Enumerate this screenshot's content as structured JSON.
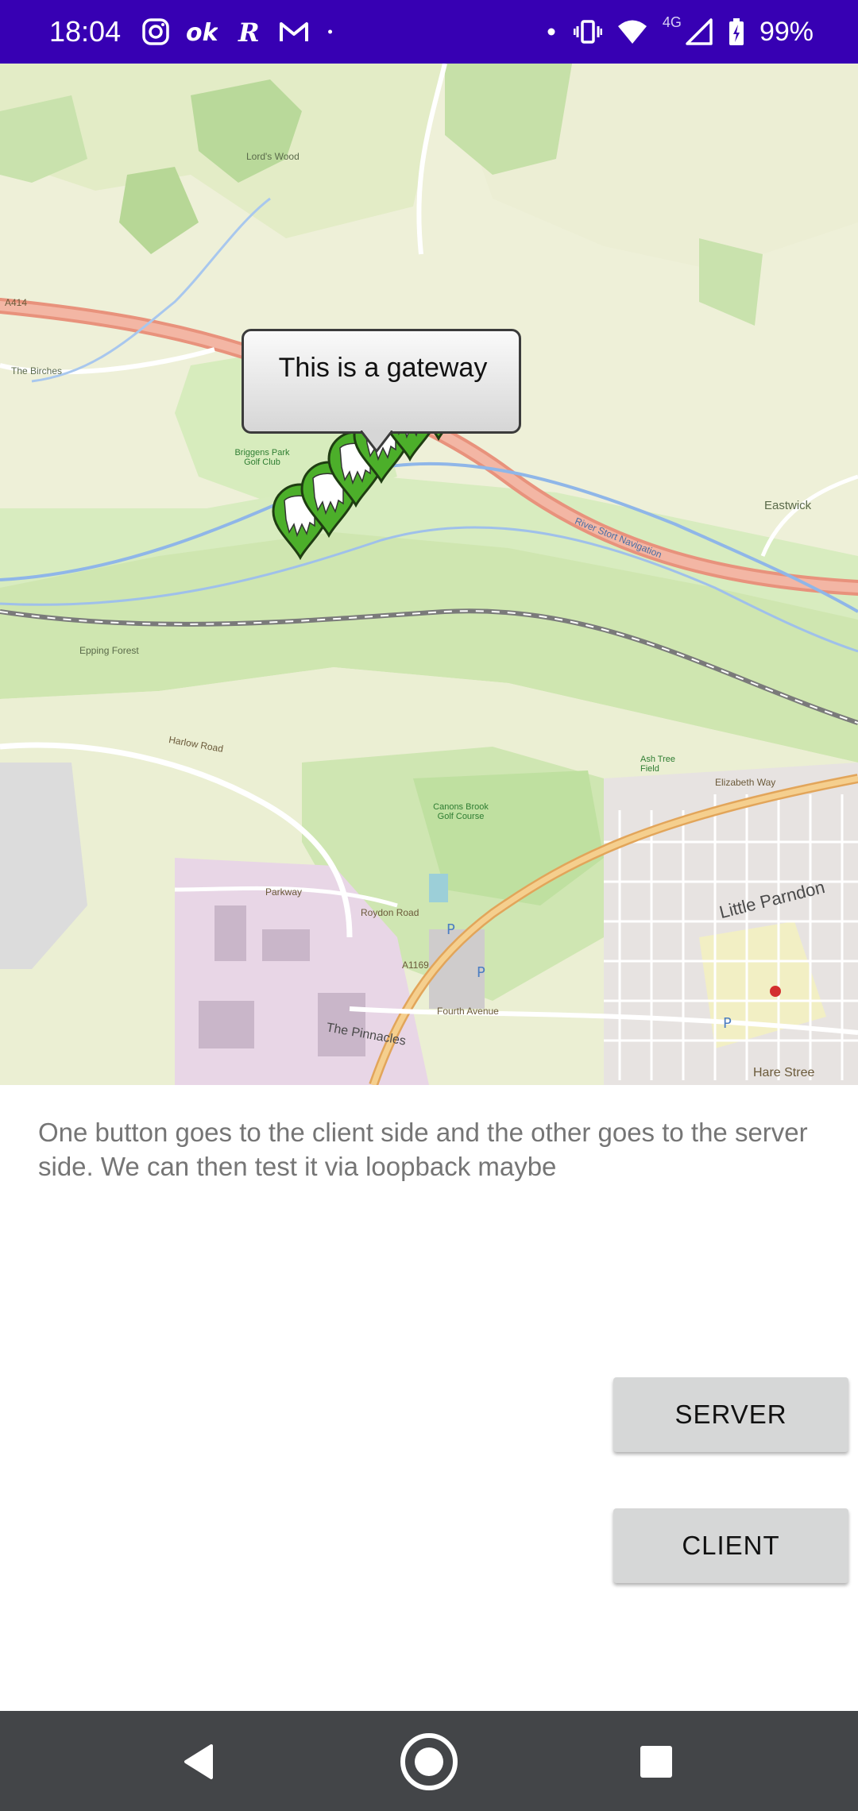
{
  "status_bar": {
    "time": "18:04",
    "network": "4G",
    "battery": "99%",
    "left_icons": [
      "instagram-icon",
      "ok-icon",
      "r-icon",
      "gmail-icon",
      "dot-icon"
    ],
    "right_icons": [
      "dot-icon",
      "vibrate-icon",
      "wifi-icon",
      "signal-icon",
      "battery-icon"
    ],
    "color": "#3700b3"
  },
  "map": {
    "callout_text": "This is a gateway",
    "marker_count": 6,
    "marker_color": "#4caf2a",
    "labels": {
      "a414": "A414",
      "lords_wood": "Lord's Wood",
      "the_birches": "The Birches",
      "briggens": "Briggens Park Golf Club",
      "eastwick": "Eastwick",
      "river_stort": "River Stort Navigation",
      "epping_forest": "Epping Forest",
      "harlow_road": "Harlow Road",
      "canons_brook": "Canons Brook Golf Course",
      "elizabeth_way": "Elizabeth Way",
      "little_parndon": "Little Parndon",
      "fourth_avenue": "Fourth Avenue",
      "the_pinnacles": "The Pinnacles",
      "a1169": "A1169",
      "roydon_road": "Roydon Road",
      "parkway": "Parkway",
      "hare_street": "Hare Stree",
      "ash_tree_field": "Ash Tree Field"
    }
  },
  "description": "One button goes to the client side and the other goes to the server side. We can then test it via loopback maybe",
  "buttons": {
    "server": "SERVER",
    "client": "CLIENT"
  },
  "nav_bar": {
    "back": "back-icon",
    "home": "home-icon",
    "recents": "recents-icon"
  }
}
